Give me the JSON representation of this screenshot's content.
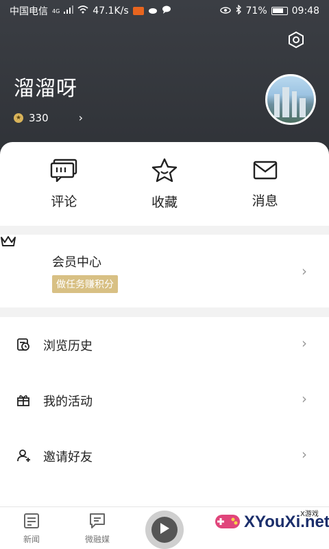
{
  "status_bar": {
    "carrier": "中国电信",
    "network": "4G",
    "speed": "47.1K/s",
    "battery": "71%",
    "time": "09:48"
  },
  "profile": {
    "username": "溜溜呀",
    "points": "330"
  },
  "quick_actions": [
    {
      "label": "评论",
      "icon": "comment-icon"
    },
    {
      "label": "收藏",
      "icon": "star-icon"
    },
    {
      "label": "消息",
      "icon": "mail-icon"
    }
  ],
  "member": {
    "title": "会员中心",
    "tag": "做任务赚积分"
  },
  "menu": [
    {
      "label": "浏览历史",
      "icon": "history-icon"
    },
    {
      "label": "我的活动",
      "icon": "gift-icon"
    },
    {
      "label": "邀请好友",
      "icon": "invite-icon"
    }
  ],
  "tabbar": {
    "tabs": [
      {
        "label": "新闻",
        "icon": "news-icon"
      },
      {
        "label": "微融媒",
        "icon": "chat-icon"
      }
    ]
  },
  "watermark": {
    "site": "XYouXi.net",
    "tag": "X游戏"
  },
  "colors": {
    "header_bg": "#3b3e44",
    "tag_gold": "#d8c084"
  }
}
